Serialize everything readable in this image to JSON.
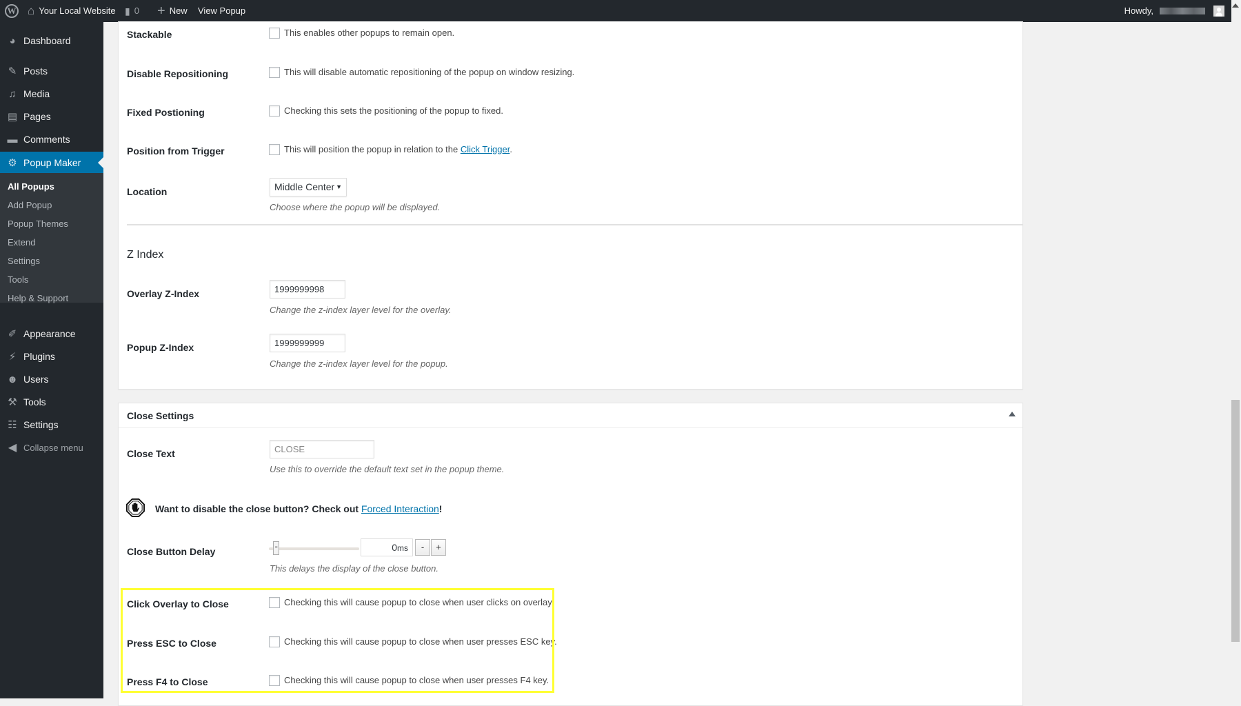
{
  "admin_bar": {
    "site_name": "Your Local Website",
    "comments_count": "0",
    "new_label": "New",
    "view_label": "View Popup",
    "greeting": "Howdy,"
  },
  "sidebar": {
    "items": [
      {
        "label": "Dashboard",
        "icon": "dashboard-icon"
      },
      {
        "label": "Posts",
        "icon": "pin-icon"
      },
      {
        "label": "Media",
        "icon": "media-icon"
      },
      {
        "label": "Pages",
        "icon": "pages-icon"
      },
      {
        "label": "Comments",
        "icon": "comment-icon"
      },
      {
        "label": "Popup Maker",
        "icon": "popup-maker-icon",
        "active": true
      },
      {
        "label": "Appearance",
        "icon": "brush-icon"
      },
      {
        "label": "Plugins",
        "icon": "plugin-icon"
      },
      {
        "label": "Users",
        "icon": "user-icon"
      },
      {
        "label": "Tools",
        "icon": "wrench-icon"
      },
      {
        "label": "Settings",
        "icon": "settings-icon"
      },
      {
        "label": "Collapse menu",
        "icon": "collapse-icon"
      }
    ],
    "submenu": [
      "All Popups",
      "Add Popup",
      "Popup Themes",
      "Extend",
      "Settings",
      "Tools",
      "Help & Support"
    ]
  },
  "display_settings": {
    "stackable": {
      "label": "Stackable",
      "text": "This enables other popups to remain open.",
      "checked": false
    },
    "disable_repositioning": {
      "label": "Disable Repositioning",
      "text": "This will disable automatic repositioning of the popup on window resizing.",
      "checked": false
    },
    "fixed_positioning": {
      "label": "Fixed Postioning",
      "text": "Checking this sets the positioning of the popup to fixed.",
      "checked": false
    },
    "position_from_trigger": {
      "label": "Position from Trigger",
      "text": "This will position the popup in relation to the ",
      "link": "Click Trigger",
      "after": ".",
      "checked": false
    },
    "location": {
      "label": "Location",
      "value": "Middle Center",
      "desc": "Choose where the popup will be displayed."
    },
    "z_index": {
      "title": "Z Index",
      "overlay": {
        "label": "Overlay Z-Index",
        "value": "1999999998",
        "desc": "Change the z-index layer level for the overlay."
      },
      "popup": {
        "label": "Popup Z-Index",
        "value": "1999999999",
        "desc": "Change the z-index layer level for the popup."
      }
    }
  },
  "close_settings": {
    "title": "Close Settings",
    "close_text": {
      "label": "Close Text",
      "placeholder": "CLOSE",
      "desc": "Use this to override the default text set in the popup theme."
    },
    "note": {
      "text": "Want to disable the close button? Check out ",
      "link": "Forced Interaction",
      "after": "!"
    },
    "delay": {
      "label": "Close Button Delay",
      "value": "0",
      "unit": "ms",
      "minus": "-",
      "plus": "+",
      "desc": "This delays the display of the close button."
    },
    "click_overlay": {
      "label": "Click Overlay to Close",
      "text": "Checking this will cause popup to close when user clicks on overlay.",
      "checked": false
    },
    "press_esc": {
      "label": "Press ESC to Close",
      "text": "Checking this will cause popup to close when user presses ESC key.",
      "checked": false
    },
    "press_f4": {
      "label": "Press F4 to Close",
      "text": "Checking this will cause popup to close when user presses F4 key.",
      "checked": false
    }
  },
  "colors": {
    "accent": "#0073aa",
    "highlight": "#ffff33",
    "admin_bg": "#23282d"
  }
}
